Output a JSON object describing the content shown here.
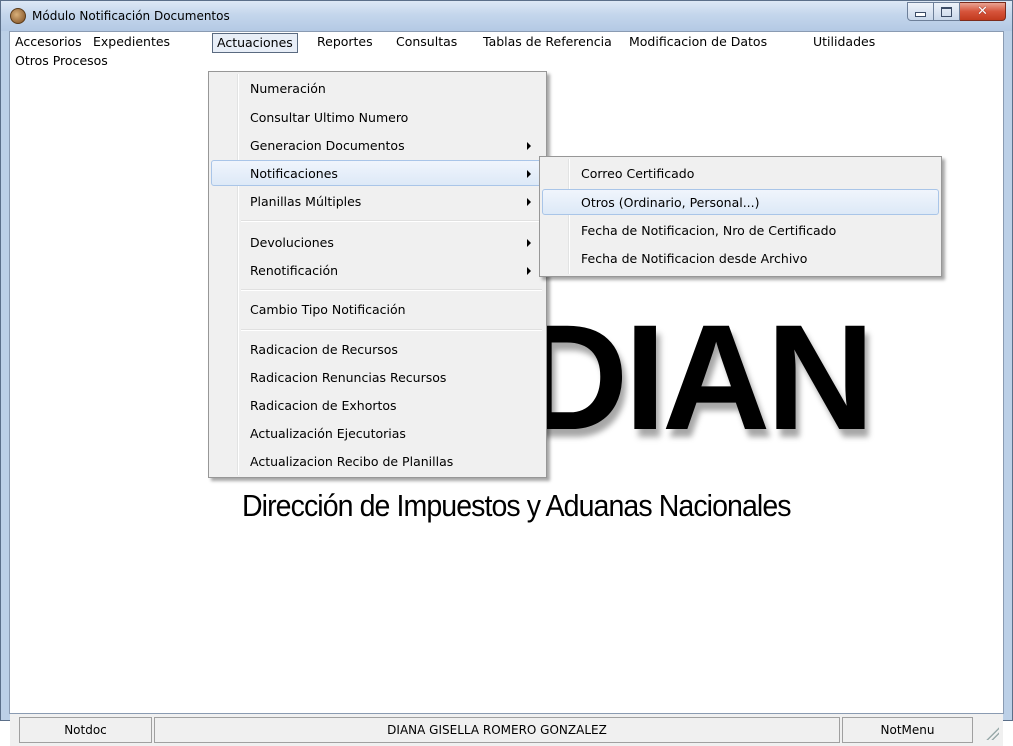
{
  "window": {
    "title": "Módulo Notificación Documentos"
  },
  "menubar": {
    "row1": [
      "Accesorios",
      "Expedientes",
      "Actuaciones",
      "Reportes",
      "Consultas",
      "Tablas de Referencia",
      "Modificacion de Datos",
      "Utilidades"
    ],
    "row2": [
      "Otros Procesos"
    ],
    "active": "Actuaciones"
  },
  "actuaciones_menu": {
    "items": [
      {
        "label": "Numeración"
      },
      {
        "label": "Consultar Ultimo Numero"
      },
      {
        "label": "Generacion Documentos",
        "submenu": true
      },
      {
        "label": "Notificaciones",
        "submenu": true,
        "highlighted": true
      },
      {
        "label": "Planillas Múltiples",
        "submenu": true
      },
      {
        "label": "Devoluciones",
        "submenu": true
      },
      {
        "label": "Renotificación",
        "submenu": true
      },
      {
        "label": "Cambio Tipo Notificación"
      },
      {
        "label": "Radicacion de Recursos"
      },
      {
        "label": "Radicacion Renuncias Recursos"
      },
      {
        "label": "Radicacion de Exhortos"
      },
      {
        "label": "Actualización Ejecutorias"
      },
      {
        "label": "Actualizacion Recibo de Planillas"
      }
    ]
  },
  "notificaciones_submenu": {
    "items": [
      {
        "label": "Correo Certificado"
      },
      {
        "label": "Otros (Ordinario, Personal...)",
        "highlighted": true
      },
      {
        "label": "Fecha de Notificacion, Nro de Certificado"
      },
      {
        "label": "Fecha de Notificacion desde Archivo"
      }
    ]
  },
  "logo": {
    "text": "DIAN",
    "subtitle": "Dirección de Impuestos y Aduanas Nacionales"
  },
  "statusbar": {
    "left": "Notdoc",
    "center": "DIANA GISELLA ROMERO GONZALEZ",
    "right": "NotMenu"
  }
}
